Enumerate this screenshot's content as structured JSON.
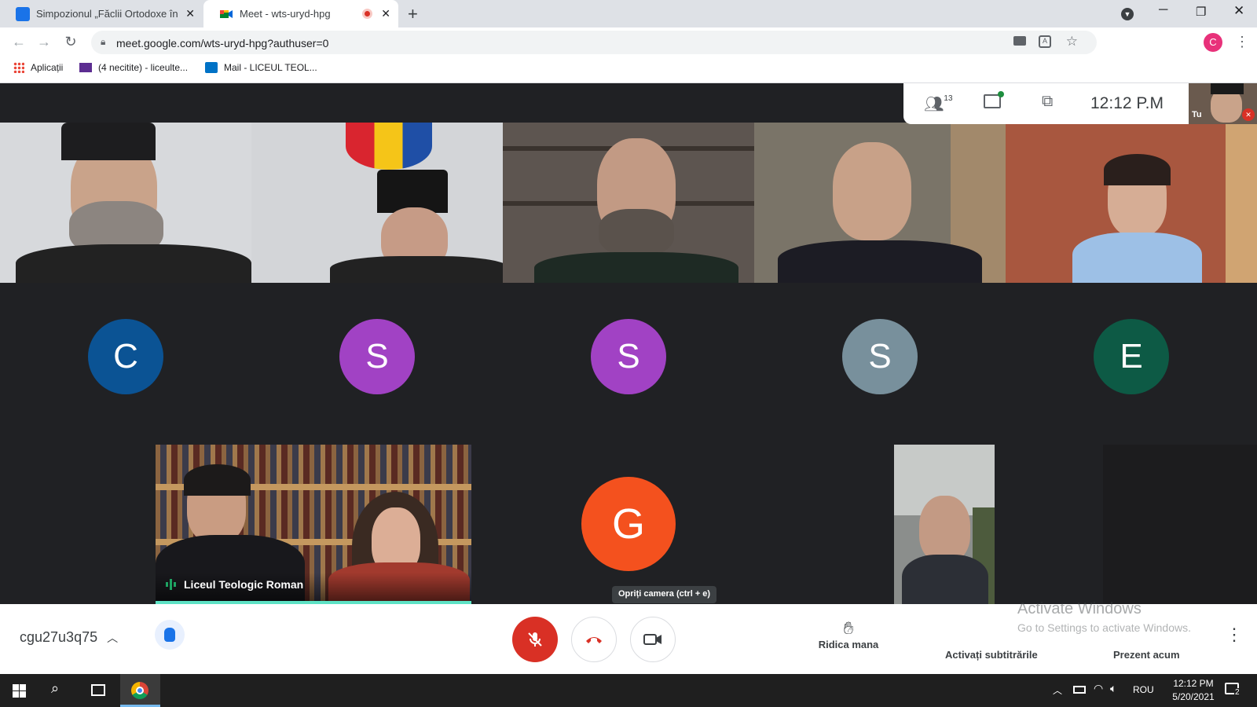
{
  "tabs": [
    {
      "title": "Simpozionul „Făclii Ortodoxe în P"
    },
    {
      "title": "Meet - wts-uryd-hpg"
    }
  ],
  "address": {
    "url": "meet.google.com/wts-uryd-hpg?authuser=0",
    "profile_initial": "C"
  },
  "bookmarks": [
    {
      "label": "Aplicații"
    },
    {
      "label": "(4 necitite) - liceulte..."
    },
    {
      "label": "Mail - LICEUL TEOL..."
    }
  ],
  "meet_info": {
    "participants_count": "13",
    "time": "12:12 P.M",
    "self_label": "Tu"
  },
  "avatars": [
    {
      "letter": "C",
      "color": "#0b5394"
    },
    {
      "letter": "S",
      "color": "#a142c4"
    },
    {
      "letter": "S",
      "color": "#a142c4"
    },
    {
      "letter": "S",
      "color": "#78909c"
    },
    {
      "letter": "E",
      "color": "#0d5a45"
    },
    {
      "letter": "G",
      "color": "#f4511e"
    }
  ],
  "speaker_tile": {
    "name": "Liceul Teologic Roman"
  },
  "tooltip": "Opriți camera (ctrl + e)",
  "bottom": {
    "meeting_code": "cgu27u3q75",
    "raise_hand": "Ridica mana",
    "captions": "Activați subtitrările",
    "present": "Prezent acum"
  },
  "watermark": {
    "title": "Activate Windows",
    "subtitle": "Go to Settings to activate Windows."
  },
  "taskbar": {
    "lang": "ROU",
    "time": "12:12 PM",
    "date": "5/20/2021",
    "notif_count": "2"
  }
}
